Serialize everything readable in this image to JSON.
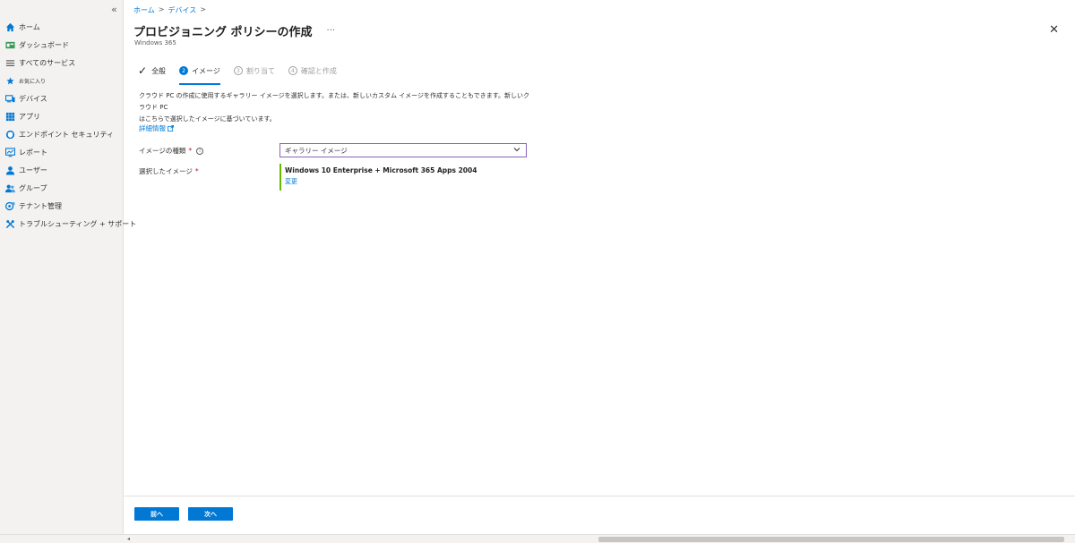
{
  "sidebar": {
    "collapse_label": "«",
    "items": [
      {
        "label": "ホーム",
        "icon": "home-icon",
        "color": "#0078d4"
      },
      {
        "label": "ダッシュボード",
        "icon": "dashboard-icon",
        "color": "#3a9b5a"
      },
      {
        "label": "すべてのサービス",
        "icon": "list-icon",
        "color": "#605e5c"
      },
      {
        "label": "お気に入り",
        "icon": "star-icon",
        "color": "#0078d4"
      },
      {
        "label": "デバイス",
        "icon": "devices-icon",
        "color": "#0078d4"
      },
      {
        "label": "アプリ",
        "icon": "apps-icon",
        "color": "#0078d4"
      },
      {
        "label": "エンドポイント セキュリティ",
        "icon": "shield-icon",
        "color": "#0078d4"
      },
      {
        "label": "レポート",
        "icon": "report-icon",
        "color": "#0078d4"
      },
      {
        "label": "ユーザー",
        "icon": "user-icon",
        "color": "#0078d4"
      },
      {
        "label": "グループ",
        "icon": "group-icon",
        "color": "#0078d4"
      },
      {
        "label": "テナント管理",
        "icon": "tenant-icon",
        "color": "#0078d4"
      },
      {
        "label": "トラブルシューティング + サポート",
        "icon": "tools-icon",
        "color": "#0078d4"
      }
    ]
  },
  "breadcrumb": {
    "items": [
      "ホーム",
      "デバイス"
    ],
    "sep": ">"
  },
  "header": {
    "title": "プロビジョニング ポリシーの作成",
    "more": "···",
    "subtitle": "Windows 365",
    "close": "✕"
  },
  "steps": [
    {
      "label": "全般",
      "num": "",
      "state": "done"
    },
    {
      "label": "イメージ",
      "num": "2",
      "state": "active"
    },
    {
      "label": "割り当て",
      "num": "3",
      "state": "disabled"
    },
    {
      "label": "確認と作成",
      "num": "4",
      "state": "disabled"
    }
  ],
  "content": {
    "description_line1": "クラウド PC の作成に使用するギャラリー イメージを選択します。または、新しいカスタム イメージを作成することもできます。新しいクラウド PC",
    "description_line2": "はこちらで選択したイメージに基づいています。",
    "more_info_link": "詳細情報",
    "image_type_label": "イメージの種類",
    "required_mark": "*",
    "info_symbol": "i",
    "image_type_value": "ギャラリー イメージ",
    "selected_image_label": "選択したイメージ",
    "selected_image_name": "Windows 10 Enterprise + Microsoft 365 Apps 2004",
    "change_link": "変更"
  },
  "footer": {
    "prev_label": "前へ",
    "next_label": "次へ"
  },
  "scrollbar": {
    "left_arrow": "◂"
  },
  "colors": {
    "accent": "#0078d4",
    "dropdown_border": "#8764b8",
    "selection_bar": "#6bb700",
    "required": "#a4262c"
  }
}
